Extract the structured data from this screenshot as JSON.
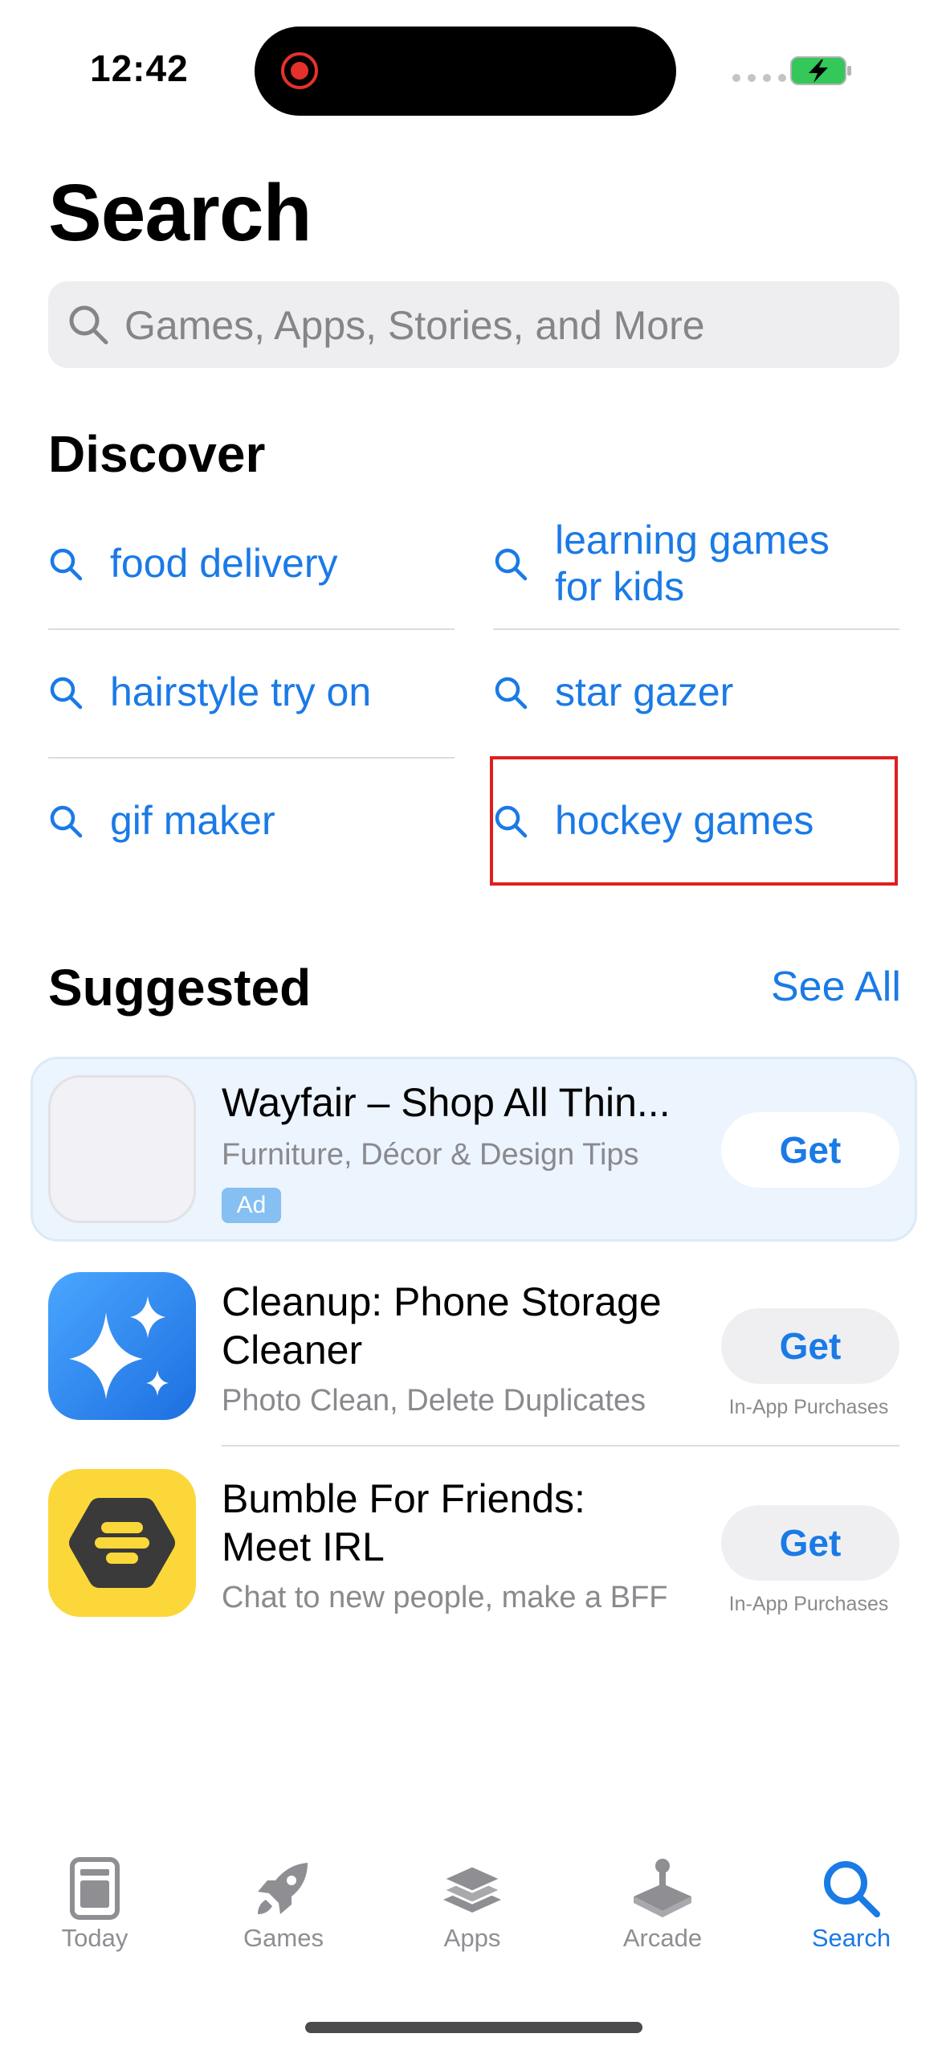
{
  "status_bar": {
    "time": "12:42"
  },
  "header": {
    "title": "Search",
    "search_placeholder": "Games, Apps, Stories, and More"
  },
  "discover": {
    "title": "Discover",
    "items": [
      {
        "label": "food delivery"
      },
      {
        "label": "learning games for kids"
      },
      {
        "label": "hairstyle try on"
      },
      {
        "label": "star gazer"
      },
      {
        "label": "gif maker"
      },
      {
        "label": "hockey games"
      }
    ]
  },
  "suggested": {
    "title": "Suggested",
    "see_all": "See All",
    "apps": [
      {
        "name": "Wayfair – Shop All Thin...",
        "subtitle": "Furniture, Décor & Design Tips",
        "badge": "Ad",
        "button": "Get"
      },
      {
        "name": "Cleanup: Phone Storage Cleaner",
        "subtitle": "Photo Clean, Delete Duplicates",
        "button": "Get",
        "note": "In-App Purchases"
      },
      {
        "name": "Bumble For Friends: Meet IRL",
        "subtitle": "Chat to new people, make a BFF",
        "button": "Get",
        "note": "In-App Purchases"
      }
    ]
  },
  "tab_bar": {
    "tabs": [
      {
        "label": "Today",
        "icon": "today-icon"
      },
      {
        "label": "Games",
        "icon": "rocket-icon"
      },
      {
        "label": "Apps",
        "icon": "layers-icon"
      },
      {
        "label": "Arcade",
        "icon": "joystick-icon"
      },
      {
        "label": "Search",
        "icon": "search-icon"
      }
    ],
    "active": "Search"
  },
  "colors": {
    "accent": "#1a7ae6",
    "highlight_box": "#e01e1e",
    "battery": "#34c759"
  }
}
